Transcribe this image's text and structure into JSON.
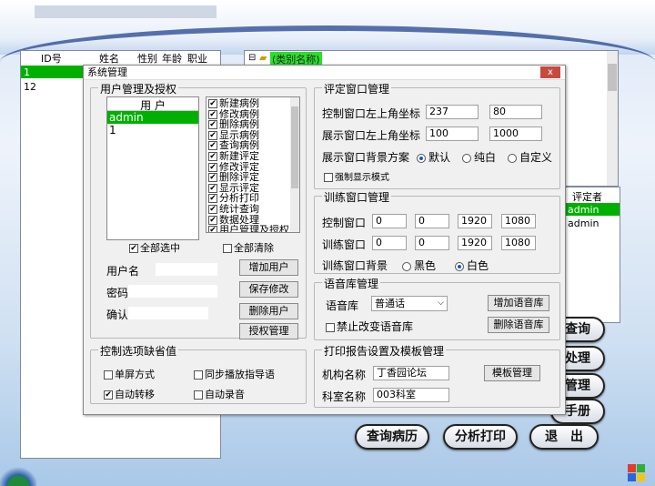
{
  "main_grid": {
    "headers": [
      "ID号",
      "姓名",
      "性别",
      "年龄",
      "职业"
    ],
    "rows": [
      {
        "id": "1"
      },
      {
        "id": "12"
      }
    ]
  },
  "tree": {
    "root_label": "(类别名称)"
  },
  "eval_list": {
    "header": "评定者",
    "items": [
      "admin",
      "admin"
    ]
  },
  "dialog": {
    "title": "系统管理",
    "close": "x",
    "user_group": {
      "legend": "用户管理及授权",
      "list_header": "用 户",
      "users": [
        "admin",
        "1"
      ],
      "permissions": [
        "新建病例",
        "修改病例",
        "删除病例",
        "显示病例",
        "查询病例",
        "新建评定",
        "修改评定",
        "删除评定",
        "显示评定",
        "分析打印",
        "统计查询",
        "数据处理",
        "用户管理及授权"
      ],
      "select_all": "全部选中",
      "clear_all": "全部清除",
      "username_label": "用户名",
      "password_label": "密码",
      "confirm_label": "确认",
      "add_user": "增加用户",
      "save_changes": "保存修改",
      "delete_user": "删除用户",
      "authorize": "授权管理"
    },
    "defaults_group": {
      "legend": "控制选项缺省值",
      "single_screen": "单屏方式",
      "sync_guide": "同步播放指导语",
      "auto_switch": "自动转移",
      "auto_record": "自动录音"
    },
    "eval_window": {
      "legend": "评定窗口管理",
      "ctrl_label": "控制窗口左上角坐标",
      "ctrl_x": "237",
      "ctrl_y": "80",
      "disp_label": "展示窗口左上角坐标",
      "disp_x": "100",
      "disp_y": "1000",
      "bg_label": "展示窗口背景方案",
      "opt_default": "默认",
      "opt_plain": "纯白",
      "opt_custom": "自定义",
      "force_show": "强制显示模式"
    },
    "train_window": {
      "legend": "训练窗口管理",
      "ctrl_label": "控制窗口",
      "ctrl_vals": [
        "0",
        "0",
        "1920",
        "1080"
      ],
      "train_label": "训练窗口",
      "train_vals": [
        "0",
        "0",
        "1920",
        "1080"
      ],
      "bg_label": "训练窗口背景",
      "opt_black": "黑色",
      "opt_white": "白色"
    },
    "voice": {
      "legend": "语音库管理",
      "lib_label": "语音库",
      "lib_value": "普通话",
      "add_lib": "增加语音库",
      "disable_change": "禁止改变语音库",
      "delete_lib": "删除语音库"
    },
    "print": {
      "legend": "打印报告设置及模板管理",
      "org_label": "机构名称",
      "org_value": "丁香园论坛",
      "dept_label": "科室名称",
      "dept_value": "003科室",
      "template_btn": "模板管理"
    }
  },
  "bottom_buttons": [
    "查询病历",
    "分析打印",
    "退　出"
  ],
  "side_buttons": [
    "查询",
    "处理",
    "管理",
    "手册"
  ]
}
